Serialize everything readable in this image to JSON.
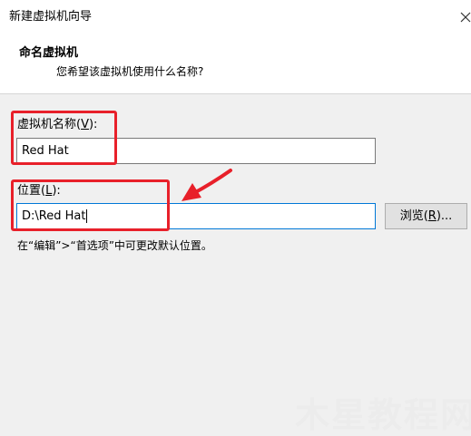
{
  "window": {
    "title": "新建虚拟机向导",
    "close_glyph": "✕"
  },
  "page": {
    "title": "命名虚拟机",
    "subtitle": "您希望该虚拟机使用什么名称?"
  },
  "vm_name": {
    "label_text": "虚拟机名称(",
    "label_key": "V",
    "label_suffix": "):",
    "value": "Red Hat"
  },
  "location": {
    "label_text": "位置(",
    "label_key": "L",
    "label_suffix": "):",
    "value": "D:\\Red Hat"
  },
  "browse_button": {
    "label_text": "浏览(",
    "label_key": "R",
    "label_suffix": ")..."
  },
  "hint": "在“编辑”>“首选项”中可更改默认位置。",
  "watermark": "木星教程网",
  "colors": {
    "highlight": "#e8202a",
    "focus_border": "#0078d7"
  }
}
